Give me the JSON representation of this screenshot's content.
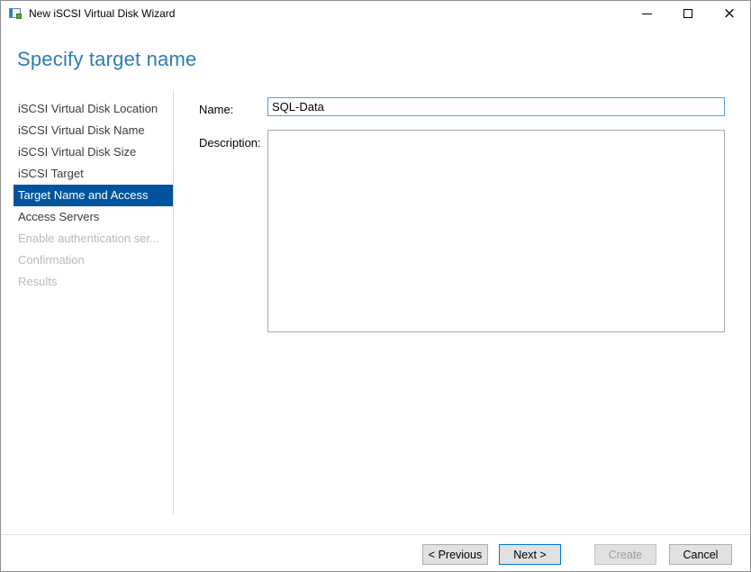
{
  "window": {
    "title": "New iSCSI Virtual Disk Wizard",
    "controls": {
      "minimize_icon": "minimize",
      "maximize_icon": "maximize",
      "close_glyph": "×"
    }
  },
  "header": {
    "title": "Specify target name"
  },
  "sidebar": {
    "items": [
      {
        "label": "iSCSI Virtual Disk Location",
        "state": "enabled"
      },
      {
        "label": "iSCSI Virtual Disk Name",
        "state": "enabled"
      },
      {
        "label": "iSCSI Virtual Disk Size",
        "state": "enabled"
      },
      {
        "label": "iSCSI Target",
        "state": "enabled"
      },
      {
        "label": "Target Name and Access",
        "state": "selected"
      },
      {
        "label": "Access Servers",
        "state": "enabled"
      },
      {
        "label": "Enable authentication ser...",
        "state": "disabled"
      },
      {
        "label": "Confirmation",
        "state": "disabled"
      },
      {
        "label": "Results",
        "state": "disabled"
      }
    ]
  },
  "form": {
    "name_label": "Name:",
    "name_value": "SQL-Data",
    "description_label": "Description:",
    "description_value": ""
  },
  "buttons": {
    "previous": "< Previous",
    "next": "Next >",
    "create": "Create",
    "cancel": "Cancel"
  },
  "colors": {
    "header_blue": "#2d7db3",
    "selected_step_bg": "#00549d",
    "focused_input_border": "#56a0d7",
    "default_button_border": "#0078d7"
  }
}
